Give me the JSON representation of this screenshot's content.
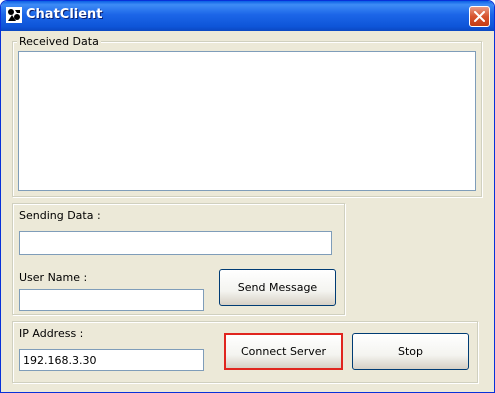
{
  "window": {
    "title": "ChatClient"
  },
  "received": {
    "label": "Received Data",
    "content": ""
  },
  "sending": {
    "label": "Sending Data :",
    "value": ""
  },
  "user": {
    "label": "User Name :",
    "value": ""
  },
  "buttons": {
    "send": "Send Message",
    "connect": "Connect Server",
    "stop": "Stop"
  },
  "connection": {
    "ip_label": "IP Address :",
    "ip_value": "192.168.3.30"
  },
  "colors": {
    "title_bar": "#0A5FE4",
    "window_bg": "#ECE9D8",
    "highlight": "#E0251E"
  },
  "icons": {
    "app": "chat-app-icon",
    "close": "close-icon"
  }
}
